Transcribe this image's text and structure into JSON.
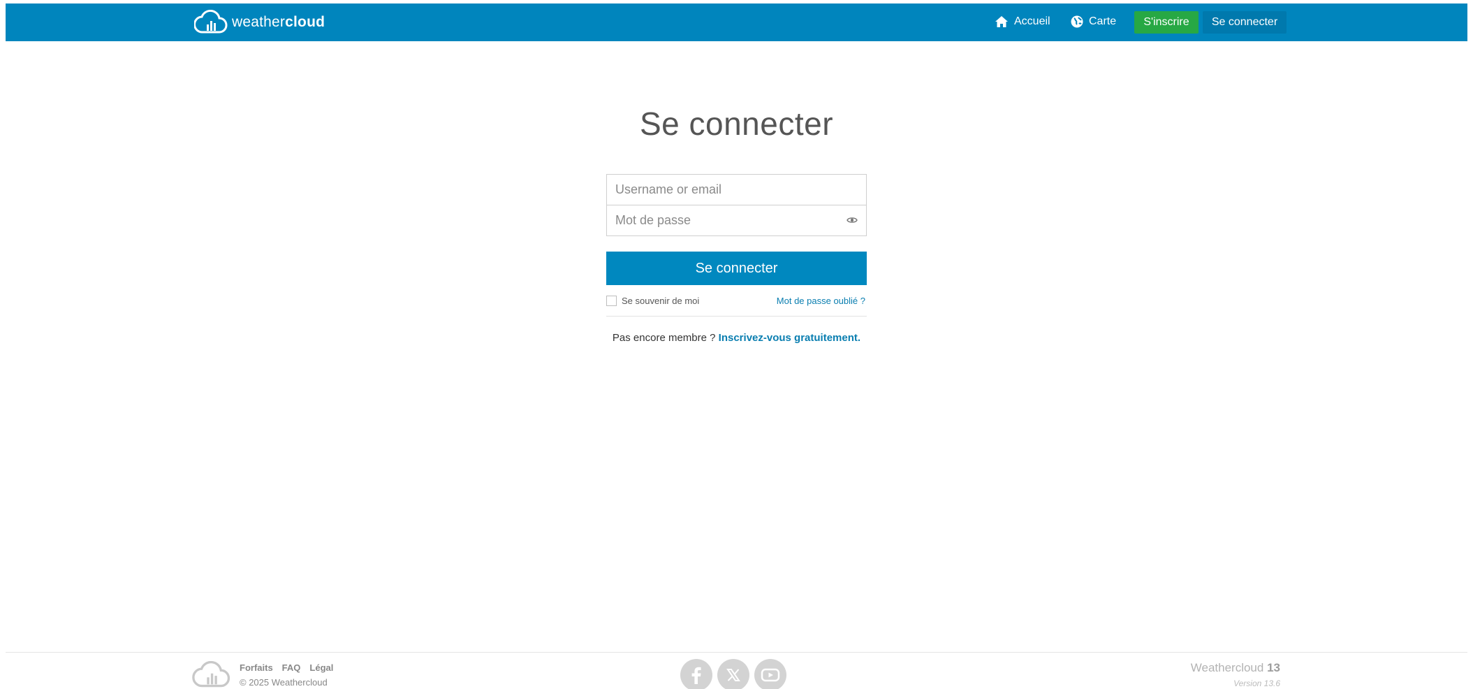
{
  "header": {
    "brand_light": "weather",
    "brand_bold": "cloud",
    "nav": {
      "home_label": "Accueil",
      "map_label": "Carte",
      "signup_label": "S'inscrire",
      "login_label": "Se connecter"
    }
  },
  "login": {
    "title": "Se connecter",
    "username_placeholder": "Username or email",
    "password_placeholder": "Mot de passe",
    "submit_label": "Se connecter",
    "remember_label": "Se souvenir de moi",
    "forgot_label": "Mot de passe oublié ?",
    "signup_prompt": "Pas encore membre ?",
    "signup_link": "Inscrivez-vous gratuitement."
  },
  "footer": {
    "links": [
      "Forfaits",
      "FAQ",
      "Légal"
    ],
    "copyright": "© 2025 Weathercloud",
    "version_name": "Weathercloud",
    "version_major": "13",
    "version_sub": "Version 13.6",
    "social": [
      "facebook-icon",
      "x-icon",
      "youtube-icon"
    ]
  },
  "colors": {
    "header_bg": "#0085bd",
    "signup_green": "#27a844",
    "primary_button": "#0088bf",
    "link_blue": "#0a7eb0"
  }
}
